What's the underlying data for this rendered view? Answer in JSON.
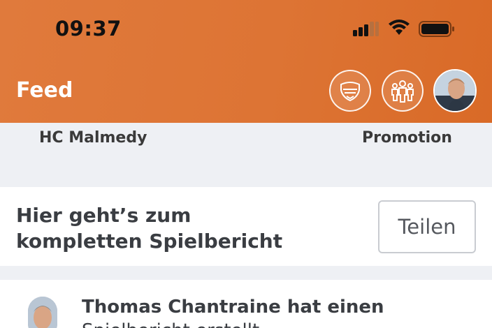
{
  "status_bar": {
    "time": "09:37",
    "signal_icon": "cellular-signal-icon",
    "wifi_icon": "wifi-icon",
    "battery_icon": "battery-icon"
  },
  "header": {
    "title": "Feed",
    "buttons": [
      {
        "icon": "club-badge-icon"
      },
      {
        "icon": "team-members-icon"
      },
      {
        "icon": "profile-avatar"
      }
    ],
    "background_color": "#dd7434"
  },
  "match": {
    "home_team": "HC Malmedy",
    "away_team": "Promotion"
  },
  "report_card": {
    "text": "Hier geht’s zum kompletten Spielbericht",
    "share_label": "Teilen"
  },
  "post": {
    "author_action": "Thomas Chantraine hat einen",
    "object": "Spielbericht",
    "verb": "erstellt"
  }
}
